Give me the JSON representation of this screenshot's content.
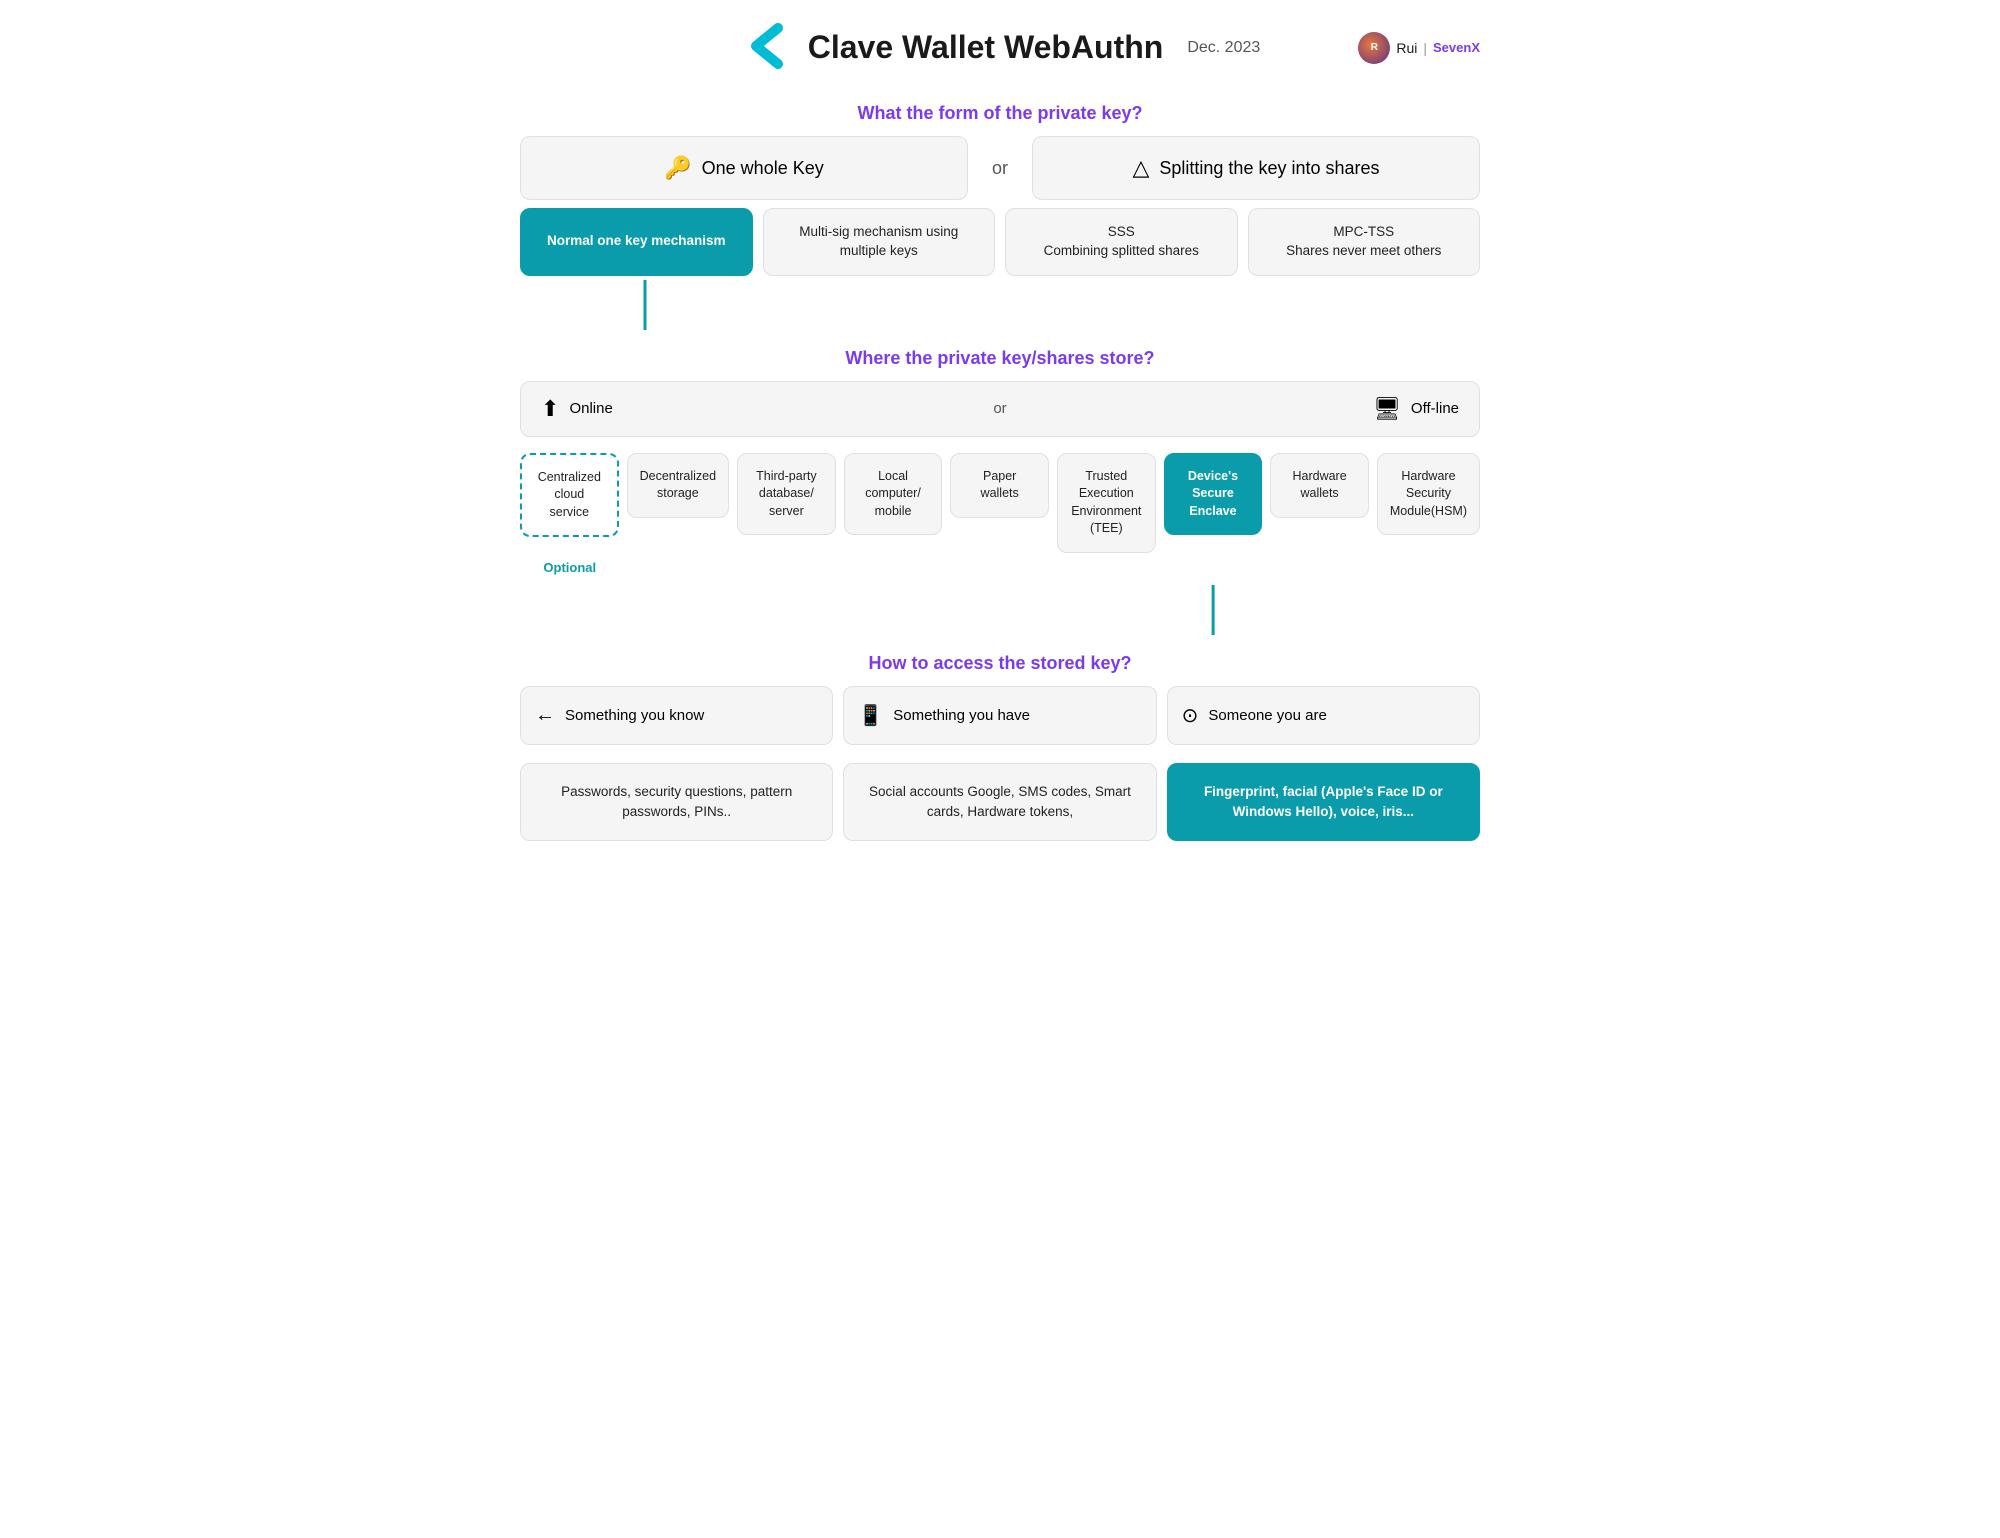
{
  "header": {
    "title": "Clave Wallet WebAuthn",
    "date": "Dec. 2023",
    "brand_name": "Rui",
    "brand_company": "SevenX",
    "brand_separator": "|"
  },
  "section1": {
    "title": "What the form of the private key?",
    "left_label": "One whole Key",
    "or": "or",
    "right_label": "Splitting the key into shares"
  },
  "mechanisms": [
    {
      "label": "Normal one key mechanism",
      "teal": true
    },
    {
      "label": "Multi-sig mechanism using multiple keys",
      "teal": false
    },
    {
      "label": "SSS\nCombining splitted shares",
      "teal": false
    },
    {
      "label": "MPC-TSS\nShares never meet others",
      "teal": false
    }
  ],
  "section2": {
    "title": "Where the private key/shares store?",
    "online_label": "Online",
    "or": "or",
    "offline_label": "Off-line"
  },
  "storage": [
    {
      "label": "Centralized cloud service",
      "dashed": true
    },
    {
      "label": "Decentralized storage",
      "dashed": false
    },
    {
      "label": "Third-party database/ server",
      "dashed": false
    },
    {
      "label": "Local computer/ mobile",
      "dashed": false
    },
    {
      "label": "Paper wallets",
      "dashed": false
    },
    {
      "label": "Trusted Execution Environment (TEE)",
      "dashed": false
    },
    {
      "label": "Device's Secure Enclave",
      "teal": true
    },
    {
      "label": "Hardware wallets",
      "dashed": false
    },
    {
      "label": "Hardware Security Module(HSM)",
      "dashed": false
    }
  ],
  "optional_label": "Optional",
  "section3": {
    "title": "How to access the stored key?",
    "access_methods": [
      {
        "icon": "←",
        "label": "Something you know"
      },
      {
        "icon": "📱",
        "label": "Something you have"
      },
      {
        "icon": "⊙",
        "label": "Someone you are"
      }
    ],
    "access_details": [
      {
        "label": "Passwords, security questions, pattern passwords, PINs..",
        "teal": false
      },
      {
        "label": "Social accounts Google, SMS codes, Smart cards, Hardware tokens,",
        "teal": false
      },
      {
        "label": "Fingerprint, facial (Apple's Face ID or Windows Hello), voice, iris...",
        "teal": true
      }
    ]
  }
}
